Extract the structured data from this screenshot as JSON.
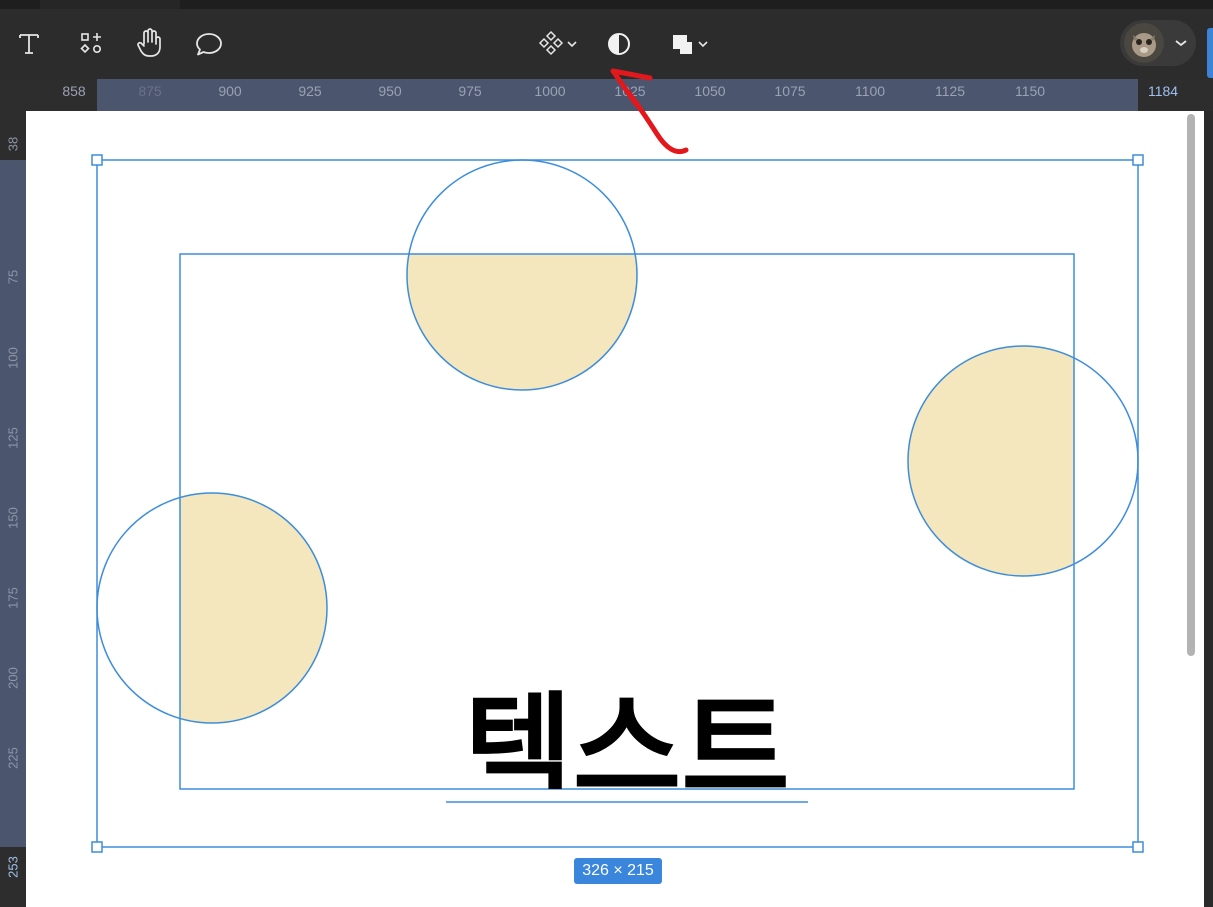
{
  "toolbar": {
    "left_tools": [
      {
        "name": "text-tool",
        "icon": "text-icon"
      },
      {
        "name": "components-tool",
        "icon": "components-icon"
      },
      {
        "name": "hand-tool",
        "icon": "hand-icon"
      },
      {
        "name": "comment-tool",
        "icon": "comment-icon"
      }
    ],
    "center_tools": [
      {
        "name": "component-instance-menu",
        "icon": "component-icon"
      },
      {
        "name": "mask-toggle",
        "icon": "contrast-icon"
      },
      {
        "name": "boolean-ops-menu",
        "icon": "boolean-union-icon"
      }
    ],
    "user": {
      "icon": "avatar"
    }
  },
  "rulers": {
    "horizontal": [
      "858",
      "875",
      "900",
      "925",
      "950",
      "975",
      "1000",
      "1025",
      "1050",
      "1075",
      "1100",
      "1125",
      "1150",
      "1184"
    ],
    "vertical": [
      "38",
      "75",
      "100",
      "125",
      "150",
      "175",
      "200",
      "225",
      "253"
    ]
  },
  "canvas": {
    "text_layer": "텍스트",
    "circle_fill": "#f4e7bd",
    "selection_color": "#3b86dd"
  },
  "selection": {
    "size_label": "326 × 215"
  },
  "colors": {
    "toolbar_bg": "#2c2c2c",
    "ruler_selection": "#4b556e",
    "accent": "#3b86dd",
    "annotation_arrow": "#e3181c"
  }
}
